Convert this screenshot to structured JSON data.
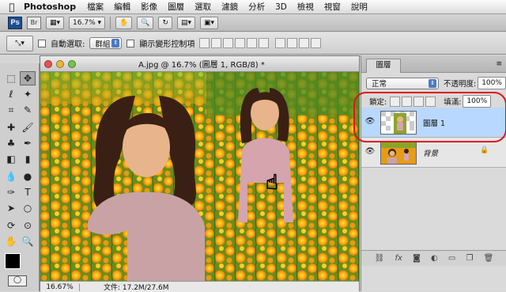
{
  "menubar": {
    "app_name": "Photoshop",
    "items": [
      "檔案",
      "編輯",
      "影像",
      "圖層",
      "選取",
      "濾鏡",
      "分析",
      "3D",
      "檢視",
      "視窗",
      "說明"
    ]
  },
  "appbar": {
    "ps_label": "Ps",
    "br_label": "Br",
    "zoom_value": "16.7%"
  },
  "options": {
    "auto_select_label": "自動選取:",
    "auto_select_value": "群組",
    "transform_label": "顯示變形控制項"
  },
  "document": {
    "title": "A.jpg @ 16.7% (圖層 1, RGB/8) *",
    "zoom": "16.67%",
    "file_info": "文件: 17.2M/27.6M"
  },
  "layers_panel": {
    "tab_label": "圖層",
    "blend_mode": "正常",
    "opacity_label": "不透明度:",
    "opacity_value": "100%",
    "lock_label": "鎖定:",
    "fill_label": "填滿:",
    "fill_value": "100%",
    "layers": [
      {
        "name": "圖層 1",
        "selected": true
      },
      {
        "name": "背景",
        "selected": false,
        "locked": true
      }
    ]
  },
  "colors": {
    "selection": "#b9d8ff",
    "annotation_circle": "#e0141d"
  }
}
